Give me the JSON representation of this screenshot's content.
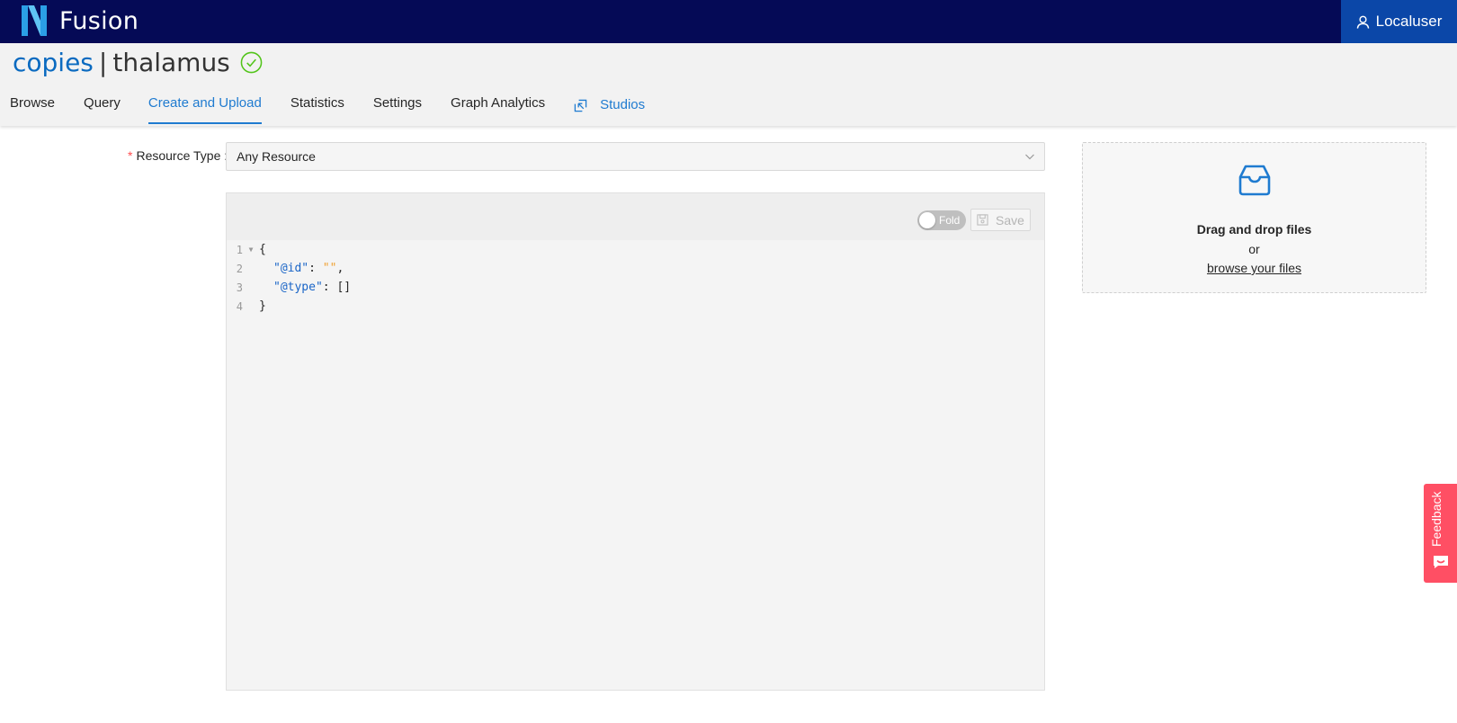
{
  "header": {
    "brand": "Fusion",
    "user": "Localuser"
  },
  "breadcrumb": {
    "org": "copies",
    "separator": "|",
    "project": "thalamus"
  },
  "tabs": [
    {
      "label": "Browse"
    },
    {
      "label": "Query"
    },
    {
      "label": "Create and Upload",
      "active": true
    },
    {
      "label": "Statistics"
    },
    {
      "label": "Settings"
    },
    {
      "label": "Graph Analytics"
    },
    {
      "label": "Studios"
    }
  ],
  "form": {
    "required_mark": "*",
    "resource_type_label": "Resource Type :",
    "resource_type_value": "Any Resource"
  },
  "editor": {
    "fold_label": "Fold",
    "save_label": "Save",
    "lines": [
      {
        "num": "1",
        "text": "{"
      },
      {
        "num": "2",
        "key": "\"@id\"",
        "colon": ": ",
        "value": "\"\"",
        "tail": ","
      },
      {
        "num": "3",
        "key": "\"@type\"",
        "colon": ": ",
        "value": "[]",
        "tail": ""
      },
      {
        "num": "4",
        "text": "}"
      }
    ]
  },
  "dropzone": {
    "title": "Drag and drop files",
    "or": "or",
    "browse": "browse your files"
  },
  "feedback": {
    "label": "Feedback"
  },
  "colors": {
    "topbar": "#050a56",
    "user_button": "#0b47a8",
    "accent": "#1f7bd0",
    "success": "#52c41a",
    "feedback": "#ff4f64"
  }
}
